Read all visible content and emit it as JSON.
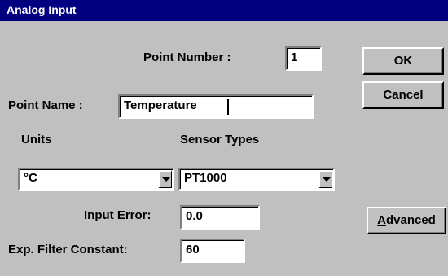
{
  "window": {
    "title": "Analog Input"
  },
  "point_number": {
    "label": "Point Number :",
    "value": "1"
  },
  "point_name": {
    "label": "Point Name :",
    "value": "Temperature"
  },
  "units": {
    "label": "Units",
    "selected": "°C"
  },
  "sensor_types": {
    "label": "Sensor Types",
    "selected": "PT1000"
  },
  "input_error": {
    "label": "Input Error:",
    "value": "0.0"
  },
  "filter_constant": {
    "label": "Exp. Filter Constant:",
    "value": "60"
  },
  "buttons": {
    "ok": "OK",
    "cancel": "Cancel",
    "advanced_mnemonic": "A",
    "advanced_rest": "dvanced"
  }
}
